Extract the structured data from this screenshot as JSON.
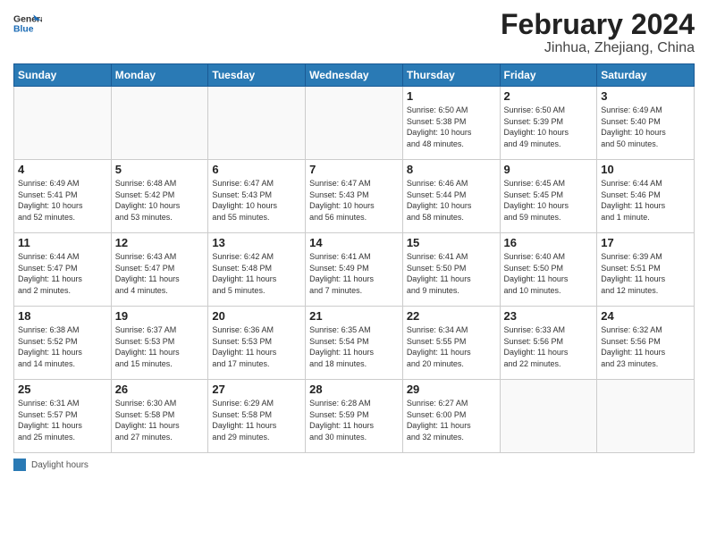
{
  "header": {
    "logo_general": "General",
    "logo_blue": "Blue",
    "month_year": "February 2024",
    "location": "Jinhua, Zhejiang, China"
  },
  "weekdays": [
    "Sunday",
    "Monday",
    "Tuesday",
    "Wednesday",
    "Thursday",
    "Friday",
    "Saturday"
  ],
  "legend": {
    "label": "Daylight hours"
  },
  "weeks": [
    [
      {
        "day": "",
        "info": ""
      },
      {
        "day": "",
        "info": ""
      },
      {
        "day": "",
        "info": ""
      },
      {
        "day": "",
        "info": ""
      },
      {
        "day": "1",
        "info": "Sunrise: 6:50 AM\nSunset: 5:38 PM\nDaylight: 10 hours\nand 48 minutes."
      },
      {
        "day": "2",
        "info": "Sunrise: 6:50 AM\nSunset: 5:39 PM\nDaylight: 10 hours\nand 49 minutes."
      },
      {
        "day": "3",
        "info": "Sunrise: 6:49 AM\nSunset: 5:40 PM\nDaylight: 10 hours\nand 50 minutes."
      }
    ],
    [
      {
        "day": "4",
        "info": "Sunrise: 6:49 AM\nSunset: 5:41 PM\nDaylight: 10 hours\nand 52 minutes."
      },
      {
        "day": "5",
        "info": "Sunrise: 6:48 AM\nSunset: 5:42 PM\nDaylight: 10 hours\nand 53 minutes."
      },
      {
        "day": "6",
        "info": "Sunrise: 6:47 AM\nSunset: 5:43 PM\nDaylight: 10 hours\nand 55 minutes."
      },
      {
        "day": "7",
        "info": "Sunrise: 6:47 AM\nSunset: 5:43 PM\nDaylight: 10 hours\nand 56 minutes."
      },
      {
        "day": "8",
        "info": "Sunrise: 6:46 AM\nSunset: 5:44 PM\nDaylight: 10 hours\nand 58 minutes."
      },
      {
        "day": "9",
        "info": "Sunrise: 6:45 AM\nSunset: 5:45 PM\nDaylight: 10 hours\nand 59 minutes."
      },
      {
        "day": "10",
        "info": "Sunrise: 6:44 AM\nSunset: 5:46 PM\nDaylight: 11 hours\nand 1 minute."
      }
    ],
    [
      {
        "day": "11",
        "info": "Sunrise: 6:44 AM\nSunset: 5:47 PM\nDaylight: 11 hours\nand 2 minutes."
      },
      {
        "day": "12",
        "info": "Sunrise: 6:43 AM\nSunset: 5:47 PM\nDaylight: 11 hours\nand 4 minutes."
      },
      {
        "day": "13",
        "info": "Sunrise: 6:42 AM\nSunset: 5:48 PM\nDaylight: 11 hours\nand 5 minutes."
      },
      {
        "day": "14",
        "info": "Sunrise: 6:41 AM\nSunset: 5:49 PM\nDaylight: 11 hours\nand 7 minutes."
      },
      {
        "day": "15",
        "info": "Sunrise: 6:41 AM\nSunset: 5:50 PM\nDaylight: 11 hours\nand 9 minutes."
      },
      {
        "day": "16",
        "info": "Sunrise: 6:40 AM\nSunset: 5:50 PM\nDaylight: 11 hours\nand 10 minutes."
      },
      {
        "day": "17",
        "info": "Sunrise: 6:39 AM\nSunset: 5:51 PM\nDaylight: 11 hours\nand 12 minutes."
      }
    ],
    [
      {
        "day": "18",
        "info": "Sunrise: 6:38 AM\nSunset: 5:52 PM\nDaylight: 11 hours\nand 14 minutes."
      },
      {
        "day": "19",
        "info": "Sunrise: 6:37 AM\nSunset: 5:53 PM\nDaylight: 11 hours\nand 15 minutes."
      },
      {
        "day": "20",
        "info": "Sunrise: 6:36 AM\nSunset: 5:53 PM\nDaylight: 11 hours\nand 17 minutes."
      },
      {
        "day": "21",
        "info": "Sunrise: 6:35 AM\nSunset: 5:54 PM\nDaylight: 11 hours\nand 18 minutes."
      },
      {
        "day": "22",
        "info": "Sunrise: 6:34 AM\nSunset: 5:55 PM\nDaylight: 11 hours\nand 20 minutes."
      },
      {
        "day": "23",
        "info": "Sunrise: 6:33 AM\nSunset: 5:56 PM\nDaylight: 11 hours\nand 22 minutes."
      },
      {
        "day": "24",
        "info": "Sunrise: 6:32 AM\nSunset: 5:56 PM\nDaylight: 11 hours\nand 23 minutes."
      }
    ],
    [
      {
        "day": "25",
        "info": "Sunrise: 6:31 AM\nSunset: 5:57 PM\nDaylight: 11 hours\nand 25 minutes."
      },
      {
        "day": "26",
        "info": "Sunrise: 6:30 AM\nSunset: 5:58 PM\nDaylight: 11 hours\nand 27 minutes."
      },
      {
        "day": "27",
        "info": "Sunrise: 6:29 AM\nSunset: 5:58 PM\nDaylight: 11 hours\nand 29 minutes."
      },
      {
        "day": "28",
        "info": "Sunrise: 6:28 AM\nSunset: 5:59 PM\nDaylight: 11 hours\nand 30 minutes."
      },
      {
        "day": "29",
        "info": "Sunrise: 6:27 AM\nSunset: 6:00 PM\nDaylight: 11 hours\nand 32 minutes."
      },
      {
        "day": "",
        "info": ""
      },
      {
        "day": "",
        "info": ""
      }
    ]
  ]
}
